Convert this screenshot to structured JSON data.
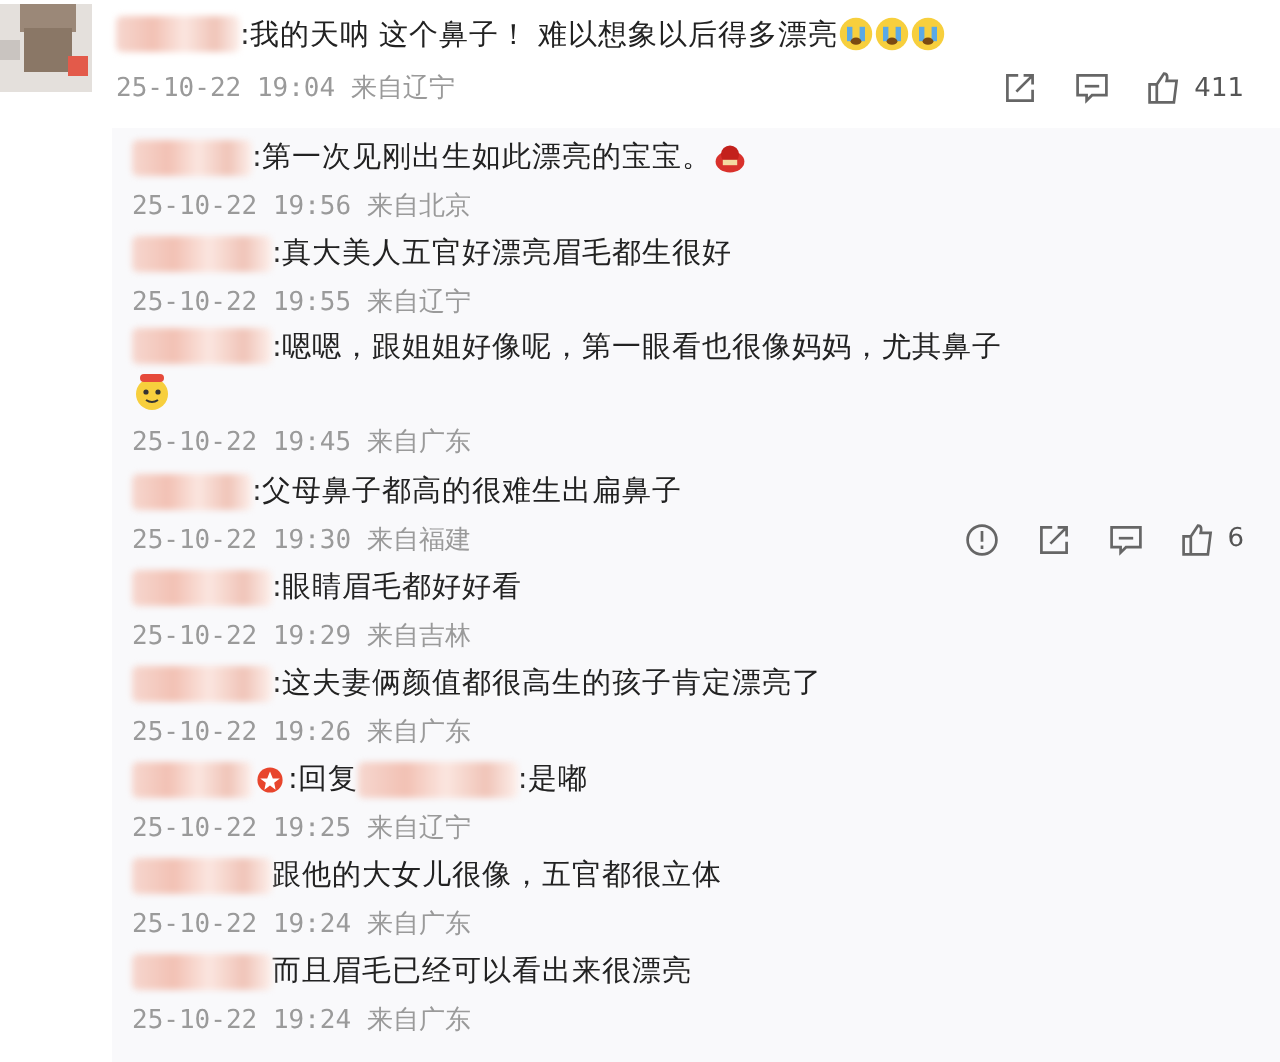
{
  "comment": {
    "text": ":我的天呐  这个鼻子！  难以想象以后得多漂亮",
    "kind": "with-crying-emoji",
    "time": "25-10-22 19:04 来自辽宁",
    "actions": [
      {
        "kind": "share"
      },
      {
        "kind": "comment"
      },
      {
        "kind": "like",
        "count": "411"
      }
    ]
  },
  "replies": [
    {
      "kind": "with-sticker",
      "text": ":第一次见刚出生如此漂亮的宝宝。",
      "time": "25-10-22 19:56 来自北京"
    },
    {
      "kind": "plain",
      "text": ":真大美人五官好漂亮眉毛都生很好",
      "time": "25-10-22 19:55 来自辽宁"
    },
    {
      "kind": "with-emoji-line",
      "text": ":嗯嗯，跟姐姐好像呢，第一眼看也很像妈妈，尤其鼻子",
      "time": "25-10-22 19:45 来自广东"
    },
    {
      "kind": "plain",
      "text": ":父母鼻子都高的很难生出扁鼻子",
      "time": "25-10-22 19:30 来自福建",
      "actions": [
        {
          "kind": "report"
        },
        {
          "kind": "share"
        },
        {
          "kind": "comment"
        },
        {
          "kind": "like",
          "count": "6"
        }
      ]
    },
    {
      "kind": "plain",
      "text": ":眼睛眉毛都好好看",
      "time": "25-10-22 19:29 来自吉林"
    },
    {
      "kind": "plain",
      "text": ":这夫妻俩颜值都很高生的孩子肯定漂亮了",
      "time": "25-10-22 19:26 来自广东"
    },
    {
      "kind": "reply-to",
      "prefix": ":回复",
      "text": ":是嘟",
      "time": "25-10-22 19:25 来自辽宁"
    },
    {
      "kind": "plain",
      "text": "跟他的大女儿很像，五官都很立体",
      "time": "25-10-22 19:24 来自广东"
    },
    {
      "kind": "plain",
      "text": "而且眉毛已经可以看出来很漂亮",
      "time": "25-10-22 19:24 来自广东"
    }
  ]
}
